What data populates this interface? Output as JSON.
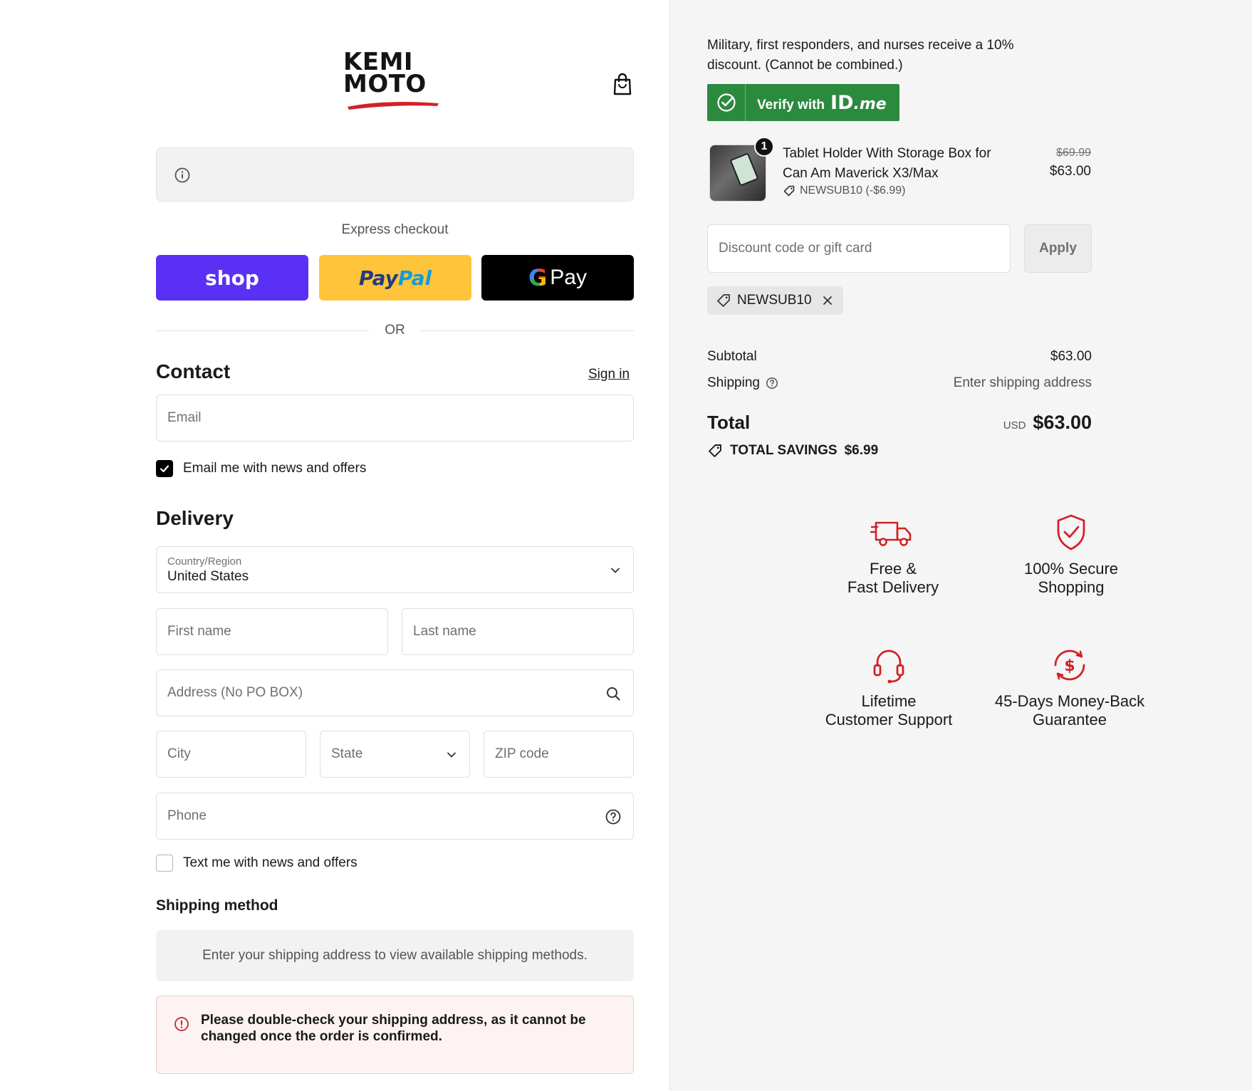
{
  "header": {
    "logo_line1": "KEMI",
    "logo_line2": "MOTO",
    "logo_accent": "#d32027"
  },
  "express": {
    "label": "Express checkout",
    "shop_label": "shop",
    "paypal_part1": "Pay",
    "paypal_part2": "Pal",
    "gpay_g": "G",
    "gpay_label": "Pay",
    "or_label": "OR"
  },
  "contact": {
    "title": "Contact",
    "sign_in": "Sign in",
    "email_placeholder": "Email",
    "email_optin_label": "Email me with news and offers",
    "email_optin_checked": true
  },
  "delivery": {
    "title": "Delivery",
    "country_label": "Country/Region",
    "country_value": "United States",
    "first_name_placeholder": "First name",
    "last_name_placeholder": "Last name",
    "address_placeholder": "Address (No PO BOX)",
    "city_placeholder": "City",
    "state_placeholder": "State",
    "zip_placeholder": "ZIP code",
    "phone_placeholder": "Phone",
    "sms_optin_label": "Text me with news and offers",
    "sms_optin_checked": false
  },
  "shipping_method": {
    "title": "Shipping method",
    "empty_message": "Enter your shipping address to view available shipping methods.",
    "warning": "Please double-check your shipping address, as it cannot be changed once the order is confirmed."
  },
  "summary": {
    "military_text": "Military, first responders, and nurses receive a 10% discount. (Cannot be combined.)",
    "idme_label": "Verify with",
    "idme_logo_main": "ID",
    "idme_logo_suffix": ".me",
    "product": {
      "name": "Tablet Holder With Storage Box for Can Am Maverick X3/Max",
      "quantity": "1",
      "discount_line": "NEWSUB10 (-$6.99)",
      "original_price": "$69.99",
      "price": "$63.00"
    },
    "discount_placeholder": "Discount code or gift card",
    "apply_label": "Apply",
    "applied_code": "NEWSUB10",
    "subtotal_label": "Subtotal",
    "subtotal_value": "$63.00",
    "shipping_label": "Shipping",
    "shipping_value": "Enter shipping address",
    "total_label": "Total",
    "total_currency": "USD",
    "total_value": "$63.00",
    "savings_label": "TOTAL SAVINGS",
    "savings_value": "$6.99"
  },
  "features": [
    {
      "line1": "Free &",
      "line2": "Fast Delivery",
      "icon": "truck-icon"
    },
    {
      "line1": "100% Secure",
      "line2": "Shopping",
      "icon": "shield-check-icon"
    },
    {
      "line1": "Lifetime",
      "line2": "Customer Support",
      "icon": "headset-icon"
    },
    {
      "line1": "45-Days Money-Back",
      "line2": "Guarantee",
      "icon": "money-back-icon"
    }
  ],
  "colors": {
    "shop_purple": "#5a31f4",
    "paypal_yellow": "#ffc439",
    "idme_green": "#2b8a3e",
    "feature_red": "#d32027"
  }
}
